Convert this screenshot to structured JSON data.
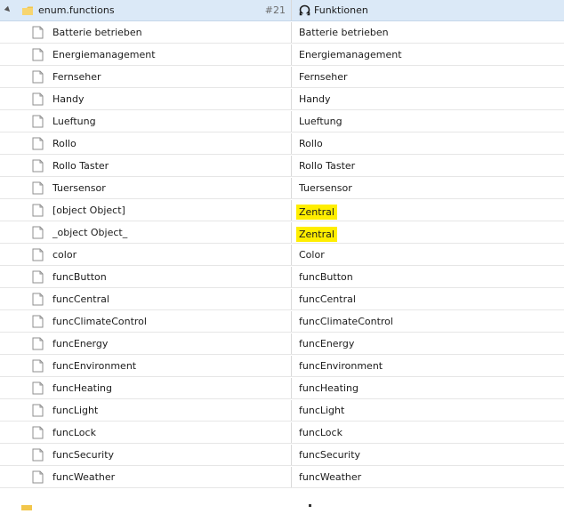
{
  "header": {
    "name": "enum.functions",
    "count": "#21",
    "value": "Funktionen"
  },
  "rows": [
    {
      "name": "Batterie betrieben",
      "value": "Batterie betrieben",
      "highlight": false
    },
    {
      "name": "Energiemanagement",
      "value": "Energiemanagement",
      "highlight": false
    },
    {
      "name": "Fernseher",
      "value": "Fernseher",
      "highlight": false
    },
    {
      "name": "Handy",
      "value": "Handy",
      "highlight": false
    },
    {
      "name": "Lueftung",
      "value": "Lueftung",
      "highlight": false
    },
    {
      "name": "Rollo",
      "value": "Rollo",
      "highlight": false
    },
    {
      "name": "Rollo Taster",
      "value": "Rollo Taster",
      "highlight": false
    },
    {
      "name": "Tuersensor",
      "value": "Tuersensor",
      "highlight": false
    },
    {
      "name": "[object Object]",
      "value": "Zentral",
      "highlight": true
    },
    {
      "name": "_object Object_",
      "value": "Zentral",
      "highlight": true
    },
    {
      "name": "color",
      "value": "Color",
      "highlight": false
    },
    {
      "name": "funcButton",
      "value": "funcButton",
      "highlight": false
    },
    {
      "name": "funcCentral",
      "value": "funcCentral",
      "highlight": false
    },
    {
      "name": "funcClimateControl",
      "value": "funcClimateControl",
      "highlight": false
    },
    {
      "name": "funcEnergy",
      "value": "funcEnergy",
      "highlight": false
    },
    {
      "name": "funcEnvironment",
      "value": "funcEnvironment",
      "highlight": false
    },
    {
      "name": "funcHeating",
      "value": "funcHeating",
      "highlight": false
    },
    {
      "name": "funcLight",
      "value": "funcLight",
      "highlight": false
    },
    {
      "name": "funcLock",
      "value": "funcLock",
      "highlight": false
    },
    {
      "name": "funcSecurity",
      "value": "funcSecurity",
      "highlight": false
    },
    {
      "name": "funcWeather",
      "value": "funcWeather",
      "highlight": false
    }
  ],
  "icons": {
    "expand": "expand-arrow-icon",
    "folder": "folder-icon",
    "document": "document-icon",
    "function": "function-icon"
  },
  "colors": {
    "header_bg": "#dbe9f7",
    "highlight": "#ffee00"
  }
}
